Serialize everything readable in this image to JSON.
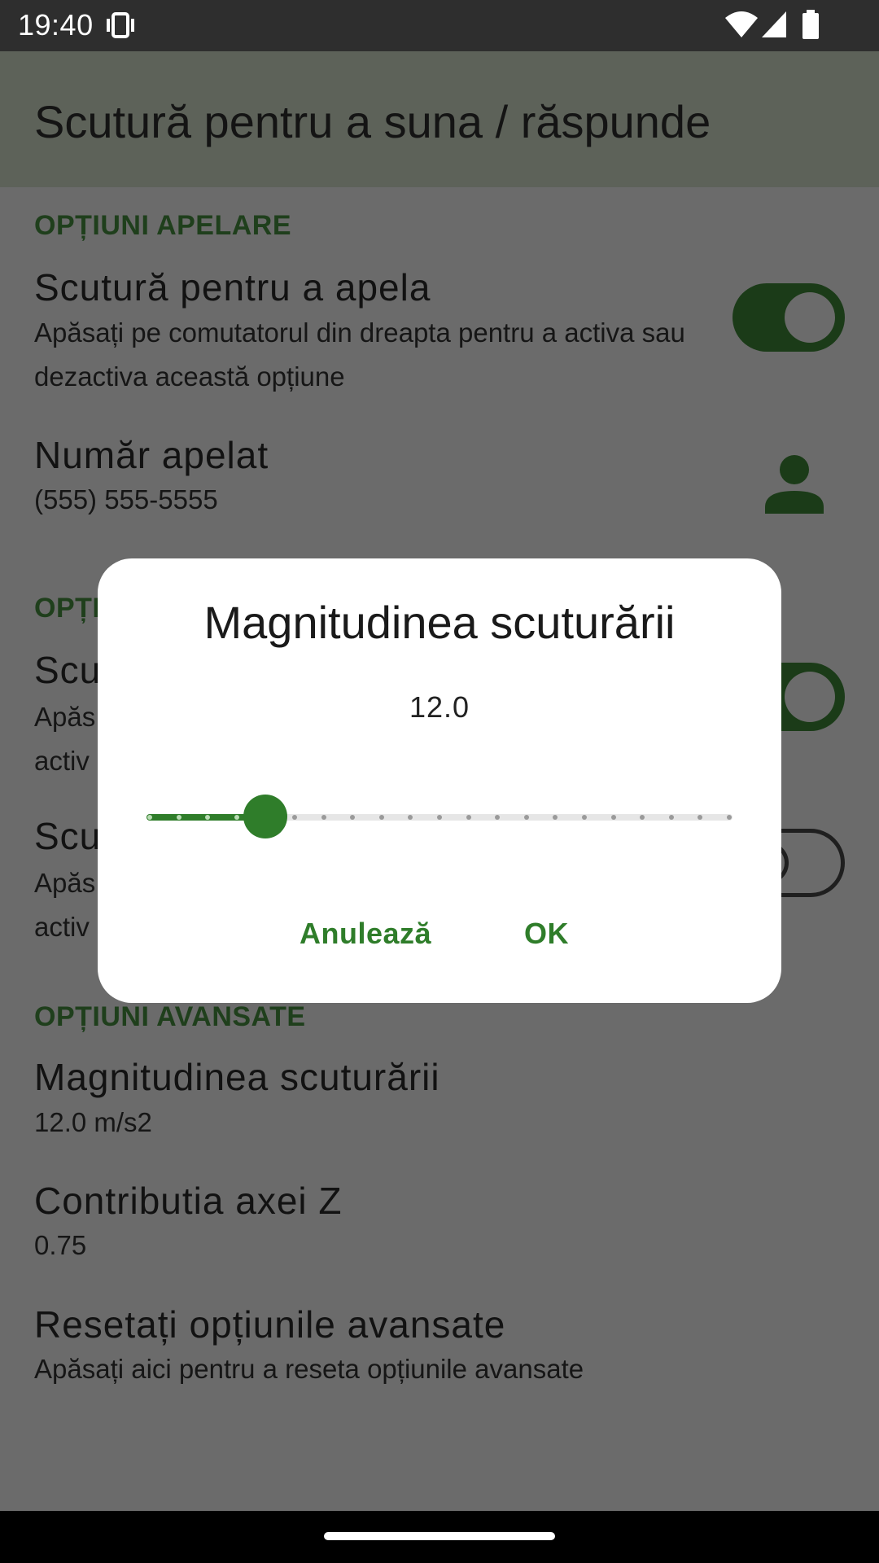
{
  "status_bar": {
    "time": "19:40",
    "icons": [
      "vibrate-icon",
      "wifi-icon",
      "cell-signal-icon",
      "battery-icon"
    ]
  },
  "app_bar": {
    "title": "Scutură pentru a suna / răspunde"
  },
  "categories": {
    "call_options": "OPȚIUNI APELARE",
    "answer_options_partial": "OPȚI",
    "advanced_options": "OPȚIUNI AVANSATE"
  },
  "items": {
    "shake_to_call": {
      "title": "Scutură pentru a apela",
      "summary": "Apăsați pe comutatorul din dreapta pentru a activa sau dezactiva această opțiune",
      "enabled": true
    },
    "called_number": {
      "title": "Număr apelat",
      "summary": "(555) 555-5555",
      "icon": "person-icon"
    },
    "answer_item_1": {
      "title": "Scu",
      "summary_line1": "Apăs",
      "summary_line2": "activ",
      "enabled": true
    },
    "answer_item_2": {
      "title": "Scu",
      "summary_line1": "Apăs",
      "summary_line2": "activ",
      "enabled": false
    },
    "shake_magnitude": {
      "title": "Magnitudinea scuturării",
      "summary": "12.0 m/s2"
    },
    "z_axis": {
      "title": "Contributia axei Z",
      "summary": "0.75"
    },
    "reset_advanced": {
      "title": "Resetați opțiunile avansate",
      "summary": "Apăsați aici pentru a reseta opțiunile avansate"
    }
  },
  "dialog": {
    "title": "Magnitudinea scuturării",
    "value": "12.0",
    "slider": {
      "steps": 21,
      "selected_step": 4
    },
    "cancel_label": "Anulează",
    "ok_label": "OK"
  },
  "colors": {
    "accent": "#2f7d2a",
    "scrim": "#6b6b6b",
    "status_bar": "#2e2e2e"
  }
}
